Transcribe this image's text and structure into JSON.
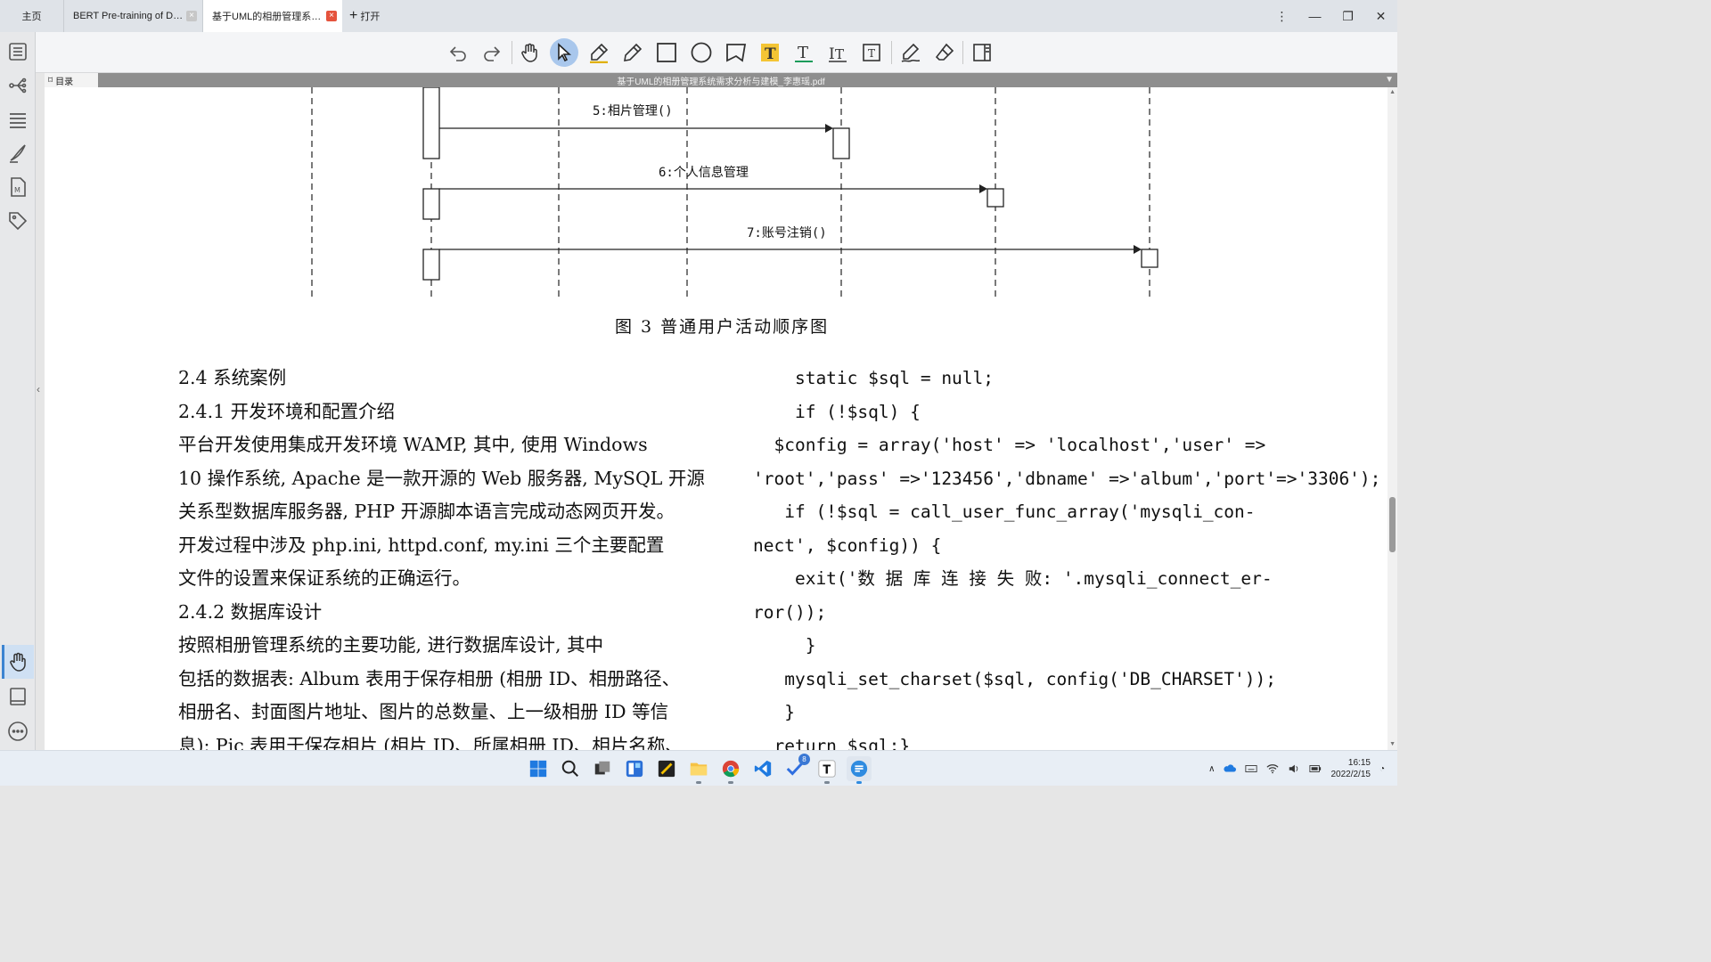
{
  "tabs": {
    "home": "主页",
    "items": [
      {
        "label": "BERT Pre-training of De..."
      },
      {
        "label": "基于UML的相册管理系统..."
      }
    ],
    "open_label": "打开"
  },
  "doc": {
    "toc_label": "目录",
    "filename": "基于UML的相册管理系统需求分析与建模_李惠瑶.pdf"
  },
  "diagram": {
    "messages": [
      "5:相片管理()",
      "6:个人信息管理",
      "7:账号注销()"
    ],
    "caption": "图 3   普通用户活动顺序图"
  },
  "left_column": [
    "2.4   系统案例",
    "2.4.1   开发环境和配置介绍",
    "    平台开发使用集成开发环境 WAMP, 其中, 使用 Windows",
    "10 操作系统, Apache 是一款开源的 Web 服务器, MySQL 开源",
    "关系型数据库服务器, PHP 开源脚本语言完成动态网页开发。",
    "开发过程中涉及 php.ini, httpd.conf, my.ini 三个主要配置",
    "文件的设置来保证系统的正确运行。",
    "2.4.2   数据库设计",
    "    按照相册管理系统的主要功能, 进行数据库设计, 其中",
    "包括的数据表: Album 表用于保存相册 (相册 ID、相册路径、",
    "相册名、封面图片地址、图片的总数量、上一级相册 ID 等信",
    "息); Pic 表用于保存相片 (相片 ID、所属相册 ID、相片名称、"
  ],
  "right_column": [
    "    static $sql = null;",
    "    if (!$sql) {",
    "  $config = array('host' => 'localhost','user' =>",
    "'root','pass' =>'123456','dbname' =>'album','port'=>'3306');",
    "   if (!$sql = call_user_func_array('mysqli_con-",
    "nect', $config)) {",
    "    exit('数 据 库 连 接 失 败: '.mysqli_connect_er-",
    "ror());",
    "     }",
    "   mysqli_set_charset($sql, config('DB_CHARSET'));",
    "   }",
    "  return $sql;}"
  ],
  "taskbar": {
    "time": "16:15",
    "date": "2022/2/15",
    "badge": "8"
  },
  "icons": {
    "sidebar": [
      "outline-icon",
      "mindmap-icon",
      "list-icon",
      "pen-icon",
      "markdown-icon",
      "tag-icon",
      "hand-icon",
      "book-icon",
      "more-icon"
    ],
    "toolbar": [
      "undo-icon",
      "redo-icon",
      "hand-tool-icon",
      "select-tool-icon",
      "highlighter-icon",
      "pencil-icon",
      "rectangle-icon",
      "ellipse-icon",
      "polygon-icon",
      "text-highlight-icon",
      "text-underline-icon",
      "text-strike-icon",
      "textbox-icon",
      "signature-icon",
      "eraser-icon",
      "panel-icon"
    ]
  }
}
